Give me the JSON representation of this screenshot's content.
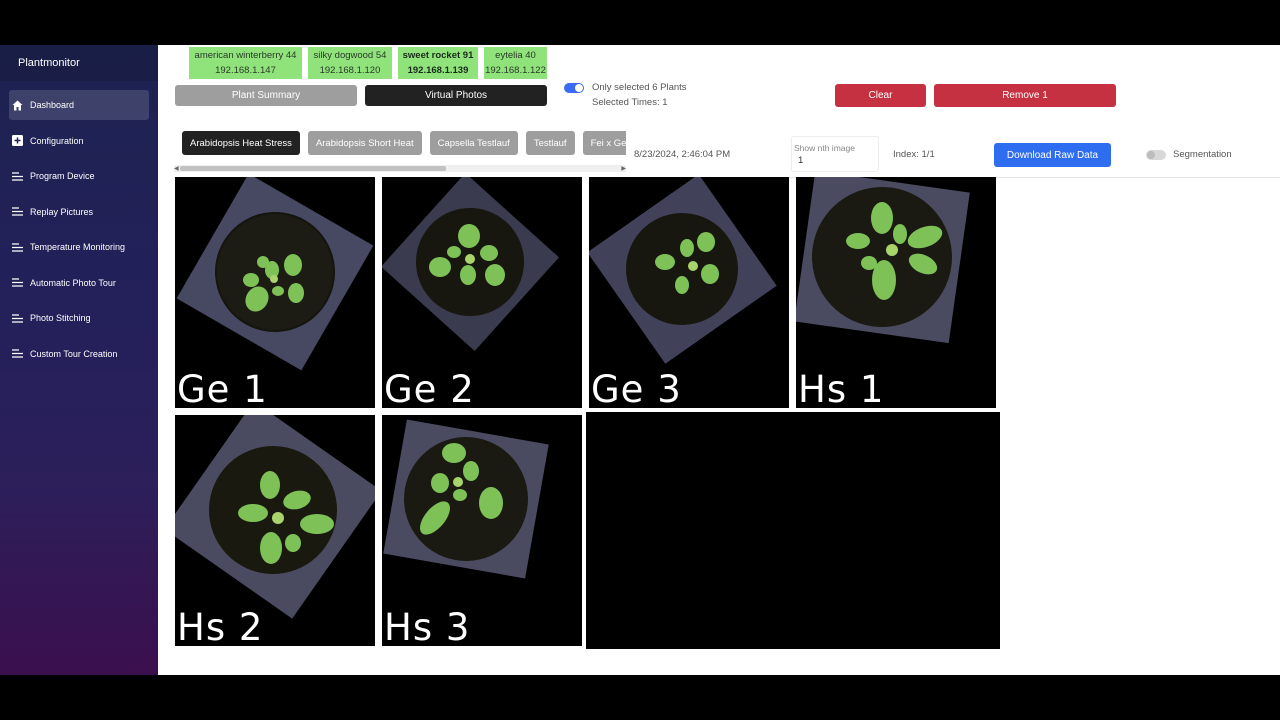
{
  "app": {
    "title": "Plantmonitor"
  },
  "sidebar": {
    "items": [
      {
        "label": "Dashboard",
        "icon": "home-icon",
        "active": true
      },
      {
        "label": "Configuration",
        "icon": "plus-square-icon",
        "active": false
      },
      {
        "label": "Program Device",
        "icon": "list-icon",
        "active": false
      },
      {
        "label": "Replay Pictures",
        "icon": "list-icon",
        "active": false
      },
      {
        "label": "Temperature Monitoring",
        "icon": "list-icon",
        "active": false
      },
      {
        "label": "Automatic Photo Tour",
        "icon": "list-icon",
        "active": false
      },
      {
        "label": "Photo Stitching",
        "icon": "list-icon",
        "active": false
      },
      {
        "label": "Custom Tour Creation",
        "icon": "list-icon",
        "active": false
      }
    ]
  },
  "devices": [
    {
      "name": "american winterberry 44",
      "ip": "192.168.1.147",
      "selected": false
    },
    {
      "name": "silky dogwood 54",
      "ip": "192.168.1.120",
      "selected": false
    },
    {
      "name": "sweet rocket 91",
      "ip": "192.168.1.139",
      "selected": true
    },
    {
      "name": "eytelia 40",
      "ip": "192.168.1.122",
      "selected": false
    }
  ],
  "views": {
    "plant_summary": "Plant Summary",
    "virtual_photos": "Virtual Photos"
  },
  "filter": {
    "only_selected": "Only selected 6 Plants",
    "selected_times": "Selected Times: 1",
    "enabled": true
  },
  "actions": {
    "clear": "Clear",
    "remove": "Remove 1"
  },
  "experiments": [
    {
      "label": "Arabidopsis Heat Stress",
      "active": true
    },
    {
      "label": "Arabidopsis Short Heat",
      "active": false
    },
    {
      "label": "Capsella Testlauf",
      "active": false
    },
    {
      "label": "Testlauf",
      "active": false
    },
    {
      "label": "Fei x Ge",
      "active": false
    }
  ],
  "viewer": {
    "timestamp": "8/23/2024, 2:46:04 PM",
    "nth_label": "Show nth image",
    "nth_value": "1",
    "index": "Index: 1/1",
    "download": "Download Raw Data",
    "segmentation": "Segmentation",
    "segmentation_enabled": false
  },
  "photos": [
    {
      "label": "Ge 1"
    },
    {
      "label": "Ge 2"
    },
    {
      "label": "Ge 3"
    },
    {
      "label": "Hs 1"
    },
    {
      "label": "Hs 2"
    },
    {
      "label": "Hs 3"
    }
  ],
  "colors": {
    "chip_green": "#8fe37a",
    "danger": "#c53140",
    "primary": "#2f6df0",
    "plant_green": "#7cc45a"
  }
}
